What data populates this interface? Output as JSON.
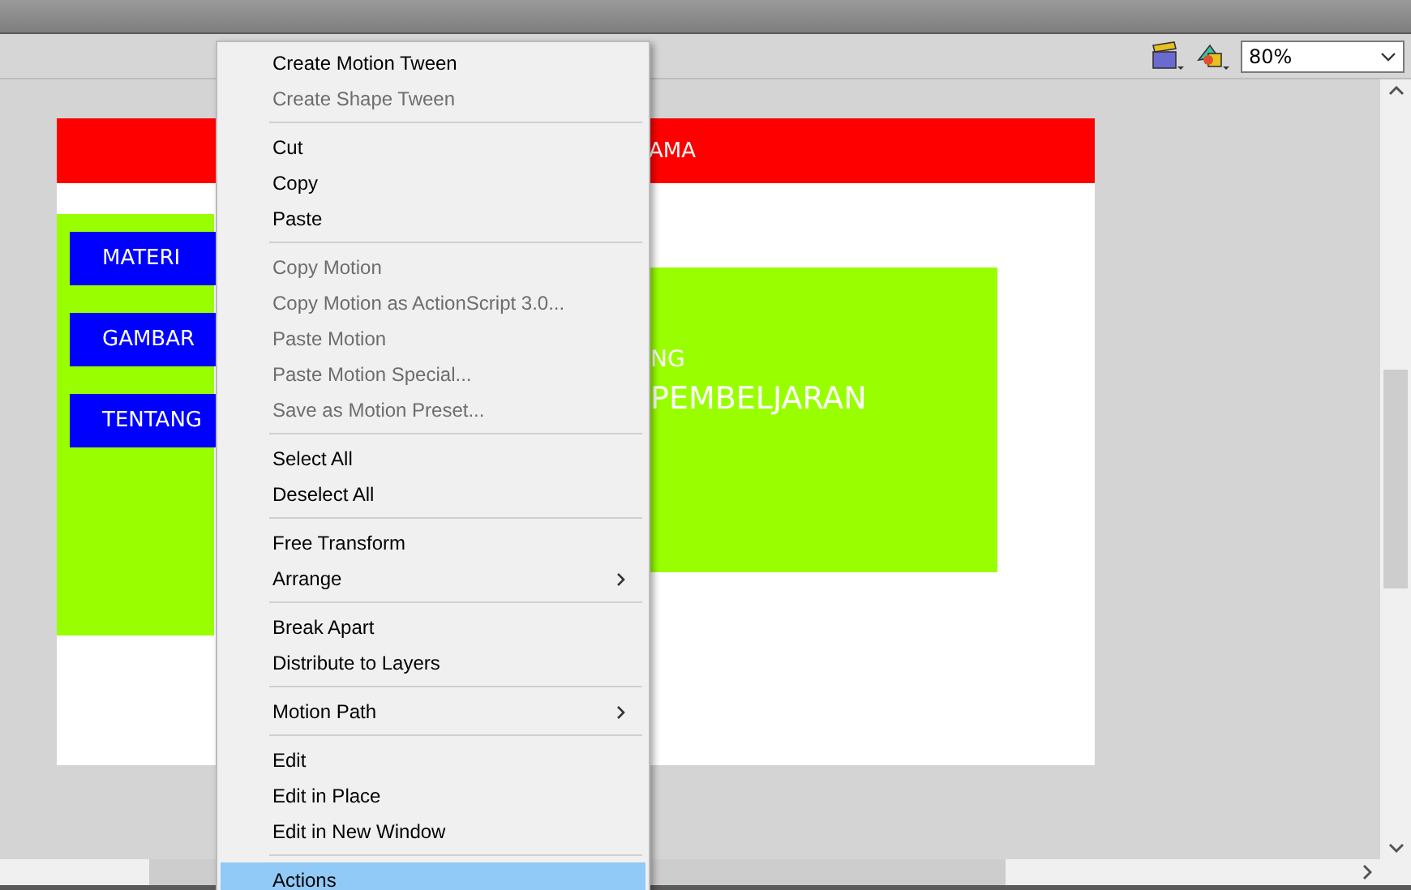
{
  "toolbar": {
    "zoom": "80%"
  },
  "stage": {
    "header_text": "AMA",
    "nav_buttons": [
      {
        "label": "MATERI"
      },
      {
        "label": "GAMBAR"
      },
      {
        "label": "TENTANG"
      }
    ],
    "content_lines": [
      "NG",
      "PEMBELJARAN"
    ]
  },
  "context_menu": {
    "items": [
      {
        "kind": "item",
        "label": "Create Motion Tween",
        "disabled": false,
        "submenu": false,
        "selected": false
      },
      {
        "kind": "item",
        "label": "Create Shape Tween",
        "disabled": true,
        "submenu": false,
        "selected": false
      },
      {
        "kind": "separator"
      },
      {
        "kind": "item",
        "label": "Cut",
        "disabled": false,
        "submenu": false,
        "selected": false
      },
      {
        "kind": "item",
        "label": "Copy",
        "disabled": false,
        "submenu": false,
        "selected": false
      },
      {
        "kind": "item",
        "label": "Paste",
        "disabled": false,
        "submenu": false,
        "selected": false
      },
      {
        "kind": "separator"
      },
      {
        "kind": "item",
        "label": "Copy Motion",
        "disabled": true,
        "submenu": false,
        "selected": false
      },
      {
        "kind": "item",
        "label": "Copy Motion as ActionScript 3.0...",
        "disabled": true,
        "submenu": false,
        "selected": false
      },
      {
        "kind": "item",
        "label": "Paste Motion",
        "disabled": true,
        "submenu": false,
        "selected": false
      },
      {
        "kind": "item",
        "label": "Paste Motion Special...",
        "disabled": true,
        "submenu": false,
        "selected": false
      },
      {
        "kind": "item",
        "label": "Save as Motion Preset...",
        "disabled": true,
        "submenu": false,
        "selected": false
      },
      {
        "kind": "separator"
      },
      {
        "kind": "item",
        "label": "Select All",
        "disabled": false,
        "submenu": false,
        "selected": false
      },
      {
        "kind": "item",
        "label": "Deselect All",
        "disabled": false,
        "submenu": false,
        "selected": false
      },
      {
        "kind": "separator"
      },
      {
        "kind": "item",
        "label": "Free Transform",
        "disabled": false,
        "submenu": false,
        "selected": false
      },
      {
        "kind": "item",
        "label": "Arrange",
        "disabled": false,
        "submenu": true,
        "selected": false
      },
      {
        "kind": "separator"
      },
      {
        "kind": "item",
        "label": "Break Apart",
        "disabled": false,
        "submenu": false,
        "selected": false
      },
      {
        "kind": "item",
        "label": "Distribute to Layers",
        "disabled": false,
        "submenu": false,
        "selected": false
      },
      {
        "kind": "separator"
      },
      {
        "kind": "item",
        "label": "Motion Path",
        "disabled": false,
        "submenu": true,
        "selected": false
      },
      {
        "kind": "separator"
      },
      {
        "kind": "item",
        "label": "Edit",
        "disabled": false,
        "submenu": false,
        "selected": false
      },
      {
        "kind": "item",
        "label": "Edit in Place",
        "disabled": false,
        "submenu": false,
        "selected": false
      },
      {
        "kind": "item",
        "label": "Edit in New Window",
        "disabled": false,
        "submenu": false,
        "selected": false
      },
      {
        "kind": "separator"
      },
      {
        "kind": "item",
        "label": "Actions",
        "disabled": false,
        "submenu": false,
        "selected": true
      }
    ]
  }
}
